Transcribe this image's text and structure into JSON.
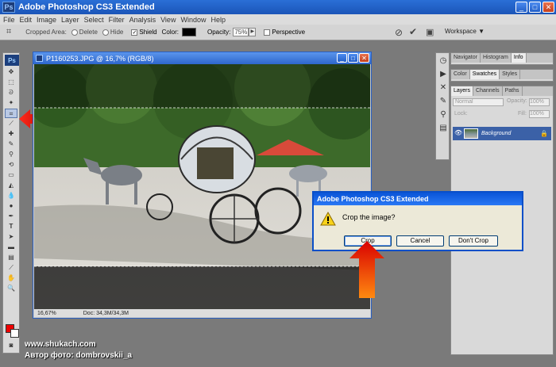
{
  "app": {
    "title": "Adobe Photoshop CS3 Extended",
    "logo": "Ps"
  },
  "menu": [
    "File",
    "Edit",
    "Image",
    "Layer",
    "Select",
    "Filter",
    "Analysis",
    "View",
    "Window",
    "Help"
  ],
  "options_bar": {
    "cropped_area_label": "Cropped Area:",
    "delete_label": "Delete",
    "hide_label": "Hide",
    "shield_label": "Shield",
    "color_label": "Color:",
    "opacity_label": "Opacity:",
    "opacity_value": "75%",
    "perspective_label": "Perspective",
    "workspace_label": "Workspace"
  },
  "document": {
    "title": "P1160253.JPG @ 16,7% (RGB/8)",
    "zoom": "16,67%",
    "doc_size": "Doc: 34,3M/34,3M"
  },
  "panels": {
    "group1_tabs": [
      "Navigator",
      "Histogram",
      "Info"
    ],
    "group2_tabs": [
      "Color",
      "Swatches",
      "Styles"
    ],
    "layers_tabs": [
      "Layers",
      "Channels",
      "Paths"
    ],
    "blend_mode": "Normal",
    "opacity_label": "Opacity:",
    "opacity_value": "100%",
    "lock_label": "Lock:",
    "fill_label": "Fill:",
    "fill_value": "100%",
    "layer_name": "Background"
  },
  "dialog": {
    "title": "Adobe Photoshop CS3 Extended",
    "message": "Crop the image?",
    "crop_button": "Crop",
    "cancel_button": "Cancel",
    "dont_crop_button": "Don't Crop"
  },
  "credits": {
    "site": "www.shukach.com",
    "author": "Автор фото: dombrovskii_a"
  },
  "colors": {
    "title_bar": "#1b55b8",
    "foreground": "#e00000",
    "background": "#ffffff",
    "arrow": "#d01010"
  }
}
